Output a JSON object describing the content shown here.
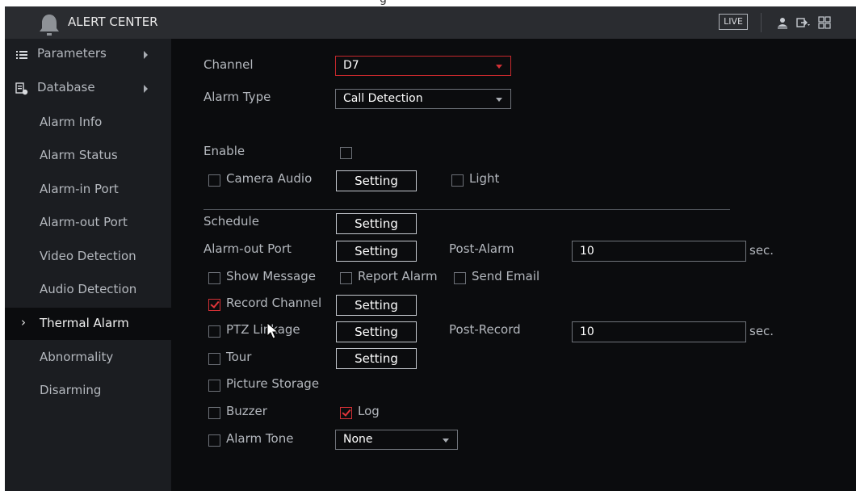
{
  "top_caption": "g",
  "header": {
    "title": "ALERT CENTER",
    "live_label": "LIVE",
    "icons": [
      "bell-icon",
      "user-icon",
      "logout-icon",
      "grid-menu-icon"
    ]
  },
  "sidebar": {
    "items": [
      {
        "label": "Parameters",
        "icon": "list-icon",
        "has_submenu": true
      },
      {
        "label": "Database",
        "icon": "database-icon",
        "has_submenu": true
      },
      {
        "label": "Alarm Info"
      },
      {
        "label": "Alarm Status"
      },
      {
        "label": "Alarm-in Port"
      },
      {
        "label": "Alarm-out Port"
      },
      {
        "label": "Video Detection"
      },
      {
        "label": "Audio Detection"
      },
      {
        "label": "Thermal Alarm",
        "active": true,
        "chevron": "›"
      },
      {
        "label": "Abnormality"
      },
      {
        "label": "Disarming"
      }
    ]
  },
  "form": {
    "channel": {
      "label": "Channel",
      "value": "D7"
    },
    "alarm_type": {
      "label": "Alarm Type",
      "value": "Call Detection"
    },
    "enable": {
      "label": "Enable",
      "checked": false
    },
    "camera_audio": {
      "label": "Camera Audio",
      "checked": false,
      "button": "Setting"
    },
    "light": {
      "label": "Light",
      "checked": false
    },
    "schedule": {
      "label": "Schedule",
      "button": "Setting"
    },
    "alarm_out_port": {
      "label": "Alarm-out Port",
      "button": "Setting"
    },
    "post_alarm": {
      "label": "Post-Alarm",
      "value": "10",
      "unit": "sec."
    },
    "show_message": {
      "label": "Show Message",
      "checked": false
    },
    "report_alarm": {
      "label": "Report Alarm",
      "checked": false
    },
    "send_email": {
      "label": "Send Email",
      "checked": false
    },
    "record_channel": {
      "label": "Record Channel",
      "checked": true,
      "button": "Setting"
    },
    "ptz_linkage": {
      "label": "PTZ Linkage",
      "checked": false,
      "button": "Setting"
    },
    "post_record": {
      "label": "Post-Record",
      "value": "10",
      "unit": "sec."
    },
    "tour": {
      "label": "Tour",
      "checked": false,
      "button": "Setting"
    },
    "picture_storage": {
      "label": "Picture Storage",
      "checked": false
    },
    "buzzer": {
      "label": "Buzzer",
      "checked": false
    },
    "log": {
      "label": "Log",
      "checked": true
    },
    "alarm_tone": {
      "label": "Alarm Tone",
      "checked": false,
      "value": "None"
    }
  },
  "colors": {
    "background": "#0b0c0e",
    "header": "#2a2c30",
    "sidebar": "#1b1d21",
    "accent_red": "#d23035",
    "text": "#b4b8be"
  }
}
